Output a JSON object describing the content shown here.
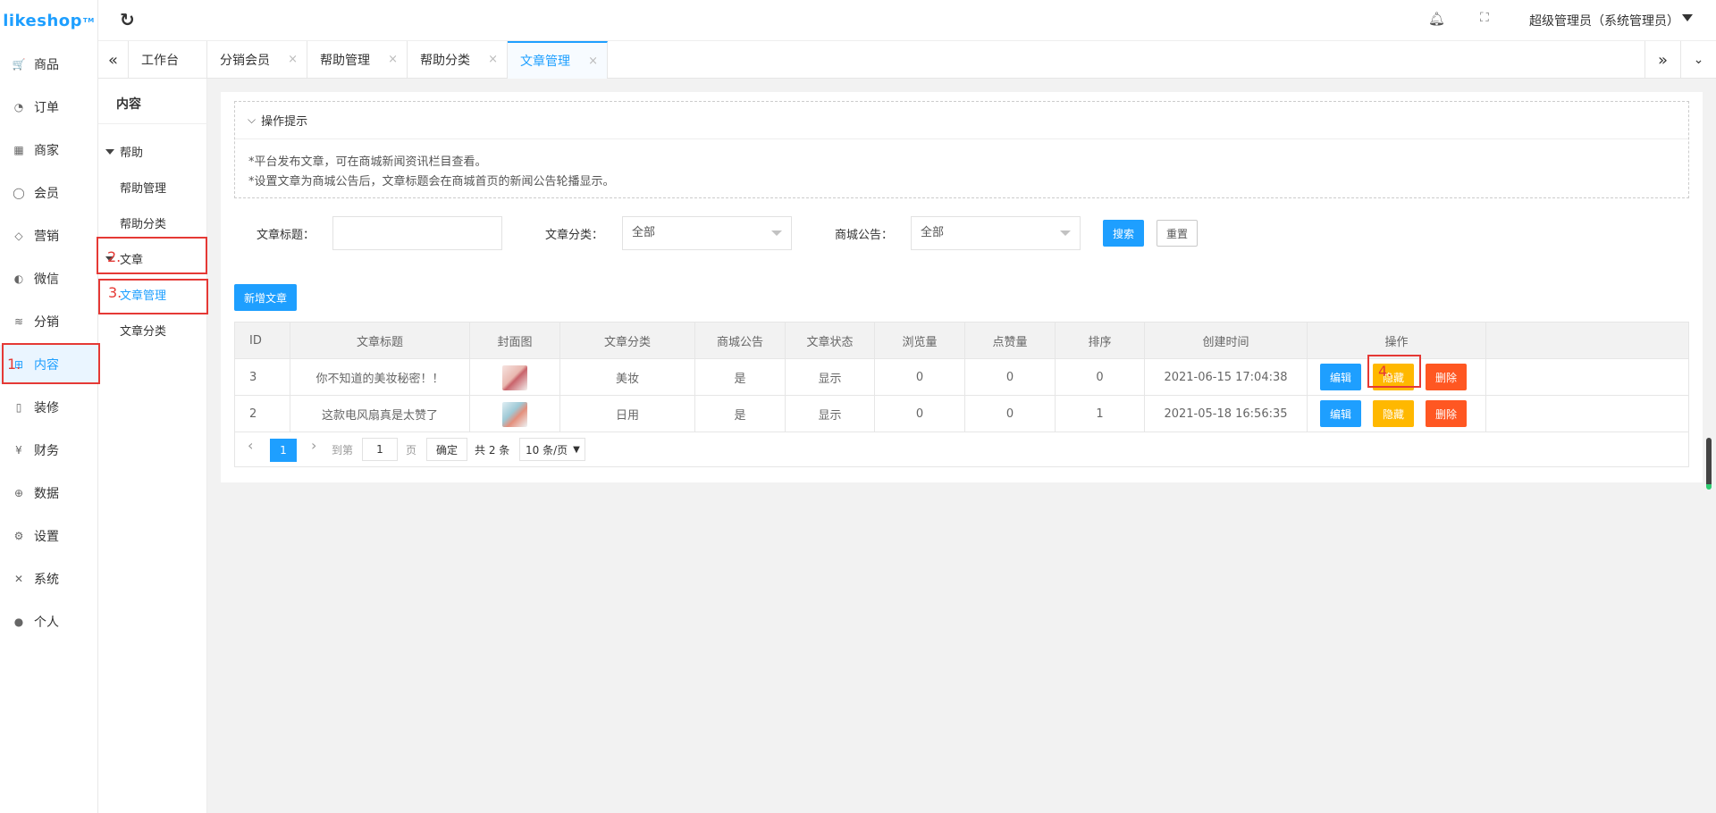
{
  "app": {
    "logo": "likeshop",
    "logo_tm": "TM",
    "admin_name": "超级管理员（系统管理员）"
  },
  "sidebar": {
    "items": [
      {
        "label": "商品",
        "icon": "cart-icon",
        "glyph": "🛒"
      },
      {
        "label": "订单",
        "icon": "bell-icon",
        "glyph": "◔"
      },
      {
        "label": "商家",
        "icon": "store-icon",
        "glyph": "▦"
      },
      {
        "label": "会员",
        "icon": "user-icon",
        "glyph": "◯"
      },
      {
        "label": "营销",
        "icon": "box-icon",
        "glyph": "◇"
      },
      {
        "label": "微信",
        "icon": "wechat-icon",
        "glyph": "◐"
      },
      {
        "label": "分销",
        "icon": "layers-icon",
        "glyph": "≋"
      },
      {
        "label": "内容",
        "icon": "content-icon",
        "glyph": "⊞"
      },
      {
        "label": "装修",
        "icon": "phone-icon",
        "glyph": "▯"
      },
      {
        "label": "财务",
        "icon": "yen-icon",
        "glyph": "¥"
      },
      {
        "label": "数据",
        "icon": "globe-icon",
        "glyph": "⊕"
      },
      {
        "label": "设置",
        "icon": "gear-icon",
        "glyph": "⚙"
      },
      {
        "label": "系统",
        "icon": "tools-icon",
        "glyph": "✕"
      },
      {
        "label": "个人",
        "icon": "person-icon",
        "glyph": "●"
      }
    ]
  },
  "tabs": {
    "items": [
      "工作台",
      "分销会员",
      "帮助管理",
      "帮助分类",
      "文章管理"
    ],
    "close": "×"
  },
  "subside": {
    "title": "内容",
    "group_help": "帮助",
    "help_manage": "帮助管理",
    "help_category": "帮助分类",
    "group_article": "文章",
    "article_manage": "文章管理",
    "article_category": "文章分类"
  },
  "tips": {
    "title": "操作提示",
    "line1": "*平台发布文章，可在商城新闻资讯栏目查看。",
    "line2": "*设置文章为商城公告后，文章标题会在商城首页的新闻公告轮播显示。"
  },
  "filters": {
    "title_label": "文章标题：",
    "title_value": "",
    "category_label": "文章分类：",
    "category_value": "全部",
    "notice_label": "商城公告：",
    "notice_value": "全部",
    "search": "搜索",
    "reset": "重置"
  },
  "add_button": "新增文章",
  "table": {
    "columns": [
      "ID",
      "文章标题",
      "封面图",
      "文章分类",
      "商城公告",
      "文章状态",
      "浏览量",
      "点赞量",
      "排序",
      "创建时间",
      "操作"
    ],
    "rows": [
      {
        "id": "3",
        "title": "你不知道的美妆秘密！！",
        "category": "美妆",
        "notice": "是",
        "status": "显示",
        "views": "0",
        "likes": "0",
        "sort": "0",
        "created": "2021-06-15 17:04:38"
      },
      {
        "id": "2",
        "title": "这款电风扇真是太赞了",
        "category": "日用",
        "notice": "是",
        "status": "显示",
        "views": "0",
        "likes": "0",
        "sort": "1",
        "created": "2021-05-18 16:56:35"
      }
    ],
    "actions": {
      "edit": "编辑",
      "hide": "隐藏",
      "delete": "删除"
    }
  },
  "pager": {
    "prev": "‹",
    "current": "1",
    "next": "›",
    "goto": "到第",
    "page_value": "1",
    "page_unit": "页",
    "confirm": "确定",
    "total": "共 2 条",
    "page_size": "10 条/页"
  },
  "annotations": [
    "1.",
    "2.",
    "3.",
    "4."
  ],
  "colors": {
    "primary": "#1e9fff",
    "warning": "#ffb800",
    "danger": "#ff5722",
    "annotation": "#e53935"
  }
}
